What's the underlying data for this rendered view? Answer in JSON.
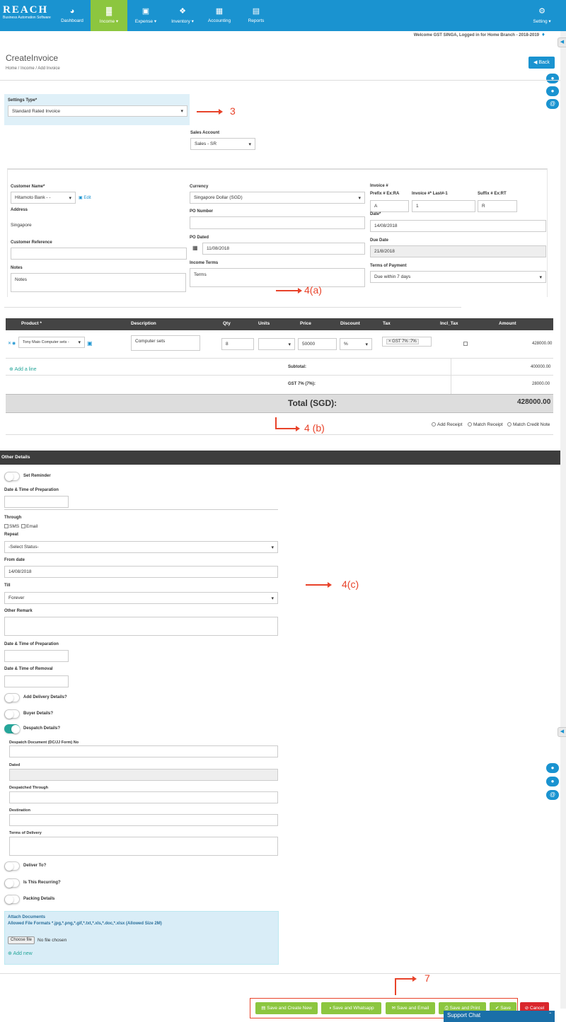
{
  "brand": {
    "logo_text": "REACH",
    "logo_sub": "Business Automation Software"
  },
  "nav": [
    {
      "label": "Dashboard",
      "icon": "dashboard-icon",
      "glyph": "◕"
    },
    {
      "label": "Income ▾",
      "icon": "bar-chart-icon",
      "glyph": "▓"
    },
    {
      "label": "Expense ▾",
      "icon": "money-icon",
      "glyph": "▣"
    },
    {
      "label": "Inventory ▾",
      "icon": "cubes-icon",
      "glyph": "❖"
    },
    {
      "label": "Accounting",
      "icon": "calculator-icon",
      "glyph": "▦"
    },
    {
      "label": "Reports",
      "icon": "document-icon",
      "glyph": "▤"
    }
  ],
  "setting": {
    "label": "Setting ▾",
    "icon": "gear-icon"
  },
  "welcome": "Welcome GST SINGA, Logged in for Home Branch - 2018-2019",
  "page": {
    "title": "CreateInvoice",
    "breadcrumb": "Home / Income / Add Invoice",
    "back_label": "◀ Back"
  },
  "settings_type": {
    "label": "Settings Type*",
    "value": "Standard Rated Invoice"
  },
  "sales_account": {
    "label": "Sales Account",
    "value": "Sales - SR"
  },
  "customer": {
    "name_label": "Customer Name*",
    "name_value": "Hitamoto Bank - -",
    "edit": "Edit",
    "address_label": "Address",
    "address_value": "Singapore",
    "ref_label": "Customer Reference",
    "ref_value": "",
    "notes_label": "Notes",
    "notes_value": "Notes"
  },
  "currency": {
    "label": "Currency",
    "value": "Singapore Dollar (SGD)"
  },
  "po_number": {
    "label": "PO Number",
    "value": ""
  },
  "po_dated": {
    "label": "PO Dated",
    "value": "11/08/2018"
  },
  "income_terms": {
    "label": "Income Terms",
    "value": "Terms"
  },
  "invoice": {
    "label": "Invoice #",
    "prefix_label": "Prefix # Ex:RA",
    "prefix": "A",
    "last_label": "Invoice #* Last#-1",
    "last": "1",
    "suffix_label": "Suffix # Ex:RT",
    "suffix": "R",
    "date_label": "Date*",
    "date": "14/08/2018",
    "due_label": "Due Date",
    "due": "21/8/2018",
    "terms_label": "Terms of Payment",
    "terms": "Due within 7 days"
  },
  "annotations": {
    "a3": "3",
    "a4a": "4(a)",
    "a4b": "4 (b)",
    "a4c": "4(c)",
    "a7": "7"
  },
  "items_table": {
    "headers": [
      "Product *",
      "Description",
      "Qty",
      "Units",
      "Price",
      "Discount",
      "Tax",
      "Incl_Tax",
      "Amount"
    ],
    "row": {
      "product": "Tony Maio Computer sets -",
      "description": "Computer sets",
      "qty": "8",
      "units": "",
      "price": "50000",
      "discount": "%",
      "tax": "× GST 7% :7%",
      "amount": "428000.00"
    },
    "add_line": "Add a line",
    "subtotal_label": "Subtotal:",
    "subtotal": "400000.00",
    "gst_label": "GST 7% (7%):",
    "gst": "28000.00",
    "total_label": "Total (SGD):",
    "total": "428000.00"
  },
  "receipt_options": [
    "Add Receipt",
    "Match Receipt",
    "Match Credit Note"
  ],
  "other": {
    "header": "Other Details",
    "set_reminder": "Set Reminder",
    "prep_label": "Date & Time of Preparation",
    "through_label": "Through",
    "sms": "SMS",
    "email": "Email",
    "repeat_label": "Repeat",
    "repeat_value": "-Select Status-",
    "from_label": "From date",
    "from_value": "14/08/2018",
    "till_label": "Till",
    "till_value": "Forever",
    "remark_label": "Other Remark",
    "prep2_label": "Date & Time of Preparation",
    "removal_label": "Date & Time of Removal",
    "add_delivery": "Add Delivery Details?",
    "buyer": "Buyer Details?",
    "despatch": "Despatch Details?",
    "despatch_doc": "Despatch Document (DC/JJ Form) No",
    "dated": "Dated",
    "through2": "Despatched Through",
    "destination": "Destination",
    "terms_delivery": "Terms of Delivery",
    "deliver_to": "Deliver To?",
    "recurring": "Is This Recurring?",
    "packing": "Packing Details"
  },
  "attach": {
    "title": "Attach Documents",
    "formats": "Allowed File Formats *.jpg,*.png,*.gif,*.txt,*.xls,*.doc,*.xlsx (Allowed Size 2M)",
    "choose": "Choose file",
    "nofile": "No file chosen",
    "add_new": "Add new"
  },
  "buttons": {
    "create_new": "▤ Save and Create New",
    "whatsapp": "◑ Save and Whatsapp",
    "email": "✉ Save and Email",
    "print": "⎙ Save and Print",
    "save": "✔ Save",
    "cancel": "⊘ Cancel"
  },
  "support_chat": "Support Chat"
}
